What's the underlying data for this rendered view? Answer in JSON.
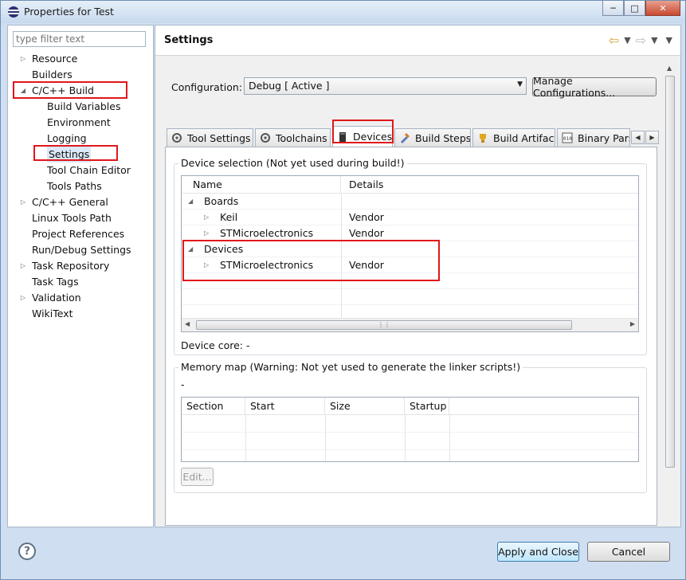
{
  "window": {
    "title": "Properties for Test"
  },
  "filter": {
    "placeholder": "type filter text"
  },
  "tree": [
    {
      "label": "Resource",
      "arrow": "collapsed"
    },
    {
      "label": "Builders",
      "arrow": "none"
    },
    {
      "label": "C/C++ Build",
      "arrow": "expanded"
    },
    {
      "label": "Build Variables",
      "arrow": "none"
    },
    {
      "label": "Environment",
      "arrow": "none"
    },
    {
      "label": "Logging",
      "arrow": "none"
    },
    {
      "label": "Settings",
      "arrow": "none",
      "selected": true
    },
    {
      "label": "Tool Chain Editor",
      "arrow": "none"
    },
    {
      "label": "Tools Paths",
      "arrow": "none"
    },
    {
      "label": "C/C++ General",
      "arrow": "collapsed"
    },
    {
      "label": "Linux Tools Path",
      "arrow": "none"
    },
    {
      "label": "Project References",
      "arrow": "none"
    },
    {
      "label": "Run/Debug Settings",
      "arrow": "none"
    },
    {
      "label": "Task Repository",
      "arrow": "collapsed"
    },
    {
      "label": "Task Tags",
      "arrow": "none"
    },
    {
      "label": "Validation",
      "arrow": "collapsed"
    },
    {
      "label": "WikiText",
      "arrow": "none"
    }
  ],
  "page": {
    "title": "Settings"
  },
  "config": {
    "label": "Configuration:",
    "value": "Debug  [ Active ]",
    "manage_label": "Manage Configurations..."
  },
  "tabs": [
    {
      "label": "Tool Settings",
      "icon": "tool-settings-icon"
    },
    {
      "label": "Toolchains",
      "icon": "toolchains-icon"
    },
    {
      "label": "Devices",
      "icon": "device-chip-icon",
      "active": true
    },
    {
      "label": "Build Steps",
      "icon": "build-steps-icon"
    },
    {
      "label": "Build Artifact",
      "icon": "build-artifact-icon"
    },
    {
      "label": "Binary Pars",
      "icon": "binary-parser-icon"
    }
  ],
  "devices": {
    "group_title": "Device selection (Not yet used during build!)",
    "columns": [
      "Name",
      "Details"
    ],
    "rows": [
      {
        "name": "Boards",
        "details": "",
        "arrow": "expanded"
      },
      {
        "name": "Keil",
        "details": "Vendor",
        "arrow": "collapsed"
      },
      {
        "name": "STMicroelectronics",
        "details": "Vendor",
        "arrow": "collapsed"
      },
      {
        "name": "Devices",
        "details": "",
        "arrow": "expanded"
      },
      {
        "name": "STMicroelectronics",
        "details": "Vendor",
        "arrow": "collapsed"
      }
    ],
    "core_label": "Device core: -"
  },
  "memory": {
    "group_title": "Memory map (Warning: Not yet used to generate the linker scripts!)",
    "dash": "-",
    "columns": [
      "Section",
      "Start",
      "Size",
      "Startup"
    ],
    "edit_label": "Edit..."
  },
  "footer": {
    "apply_close_label": "Apply and Close",
    "cancel_label": "Cancel"
  },
  "colors": {
    "highlight": "#e0171b",
    "window_bg": "#cfdff1"
  }
}
